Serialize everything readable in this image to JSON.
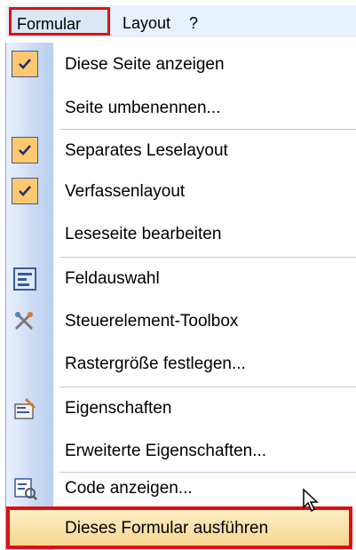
{
  "menubar": {
    "items": [
      {
        "label": "Formular"
      },
      {
        "label": "Layout"
      },
      {
        "label": "?"
      }
    ]
  },
  "menu": {
    "items": [
      {
        "label": "Diese Seite anzeigen",
        "checked": true
      },
      {
        "label": "Seite umbenennen...",
        "checked": false
      },
      {
        "label": "Separates Leselayout",
        "checked": true
      },
      {
        "label": "Verfassenlayout",
        "checked": true
      },
      {
        "label": "Leseseite bearbeiten",
        "checked": false
      },
      {
        "label": "Feldauswahl",
        "icon": "field-chooser-icon"
      },
      {
        "label": "Steuerelement-Toolbox",
        "icon": "toolbox-icon"
      },
      {
        "label": "Rastergröße festlegen...",
        "checked": false
      },
      {
        "label": "Eigenschaften",
        "icon": "properties-icon"
      },
      {
        "label": "Erweiterte Eigenschaften...",
        "checked": false
      },
      {
        "label": "Code anzeigen...",
        "icon": "view-code-icon"
      },
      {
        "label": "Dieses Formular ausführen",
        "highlighted": true
      }
    ]
  },
  "colors": {
    "highlight_border": "#e01010",
    "check_bg": "#ffc870",
    "gutter": "#cddcf3"
  }
}
